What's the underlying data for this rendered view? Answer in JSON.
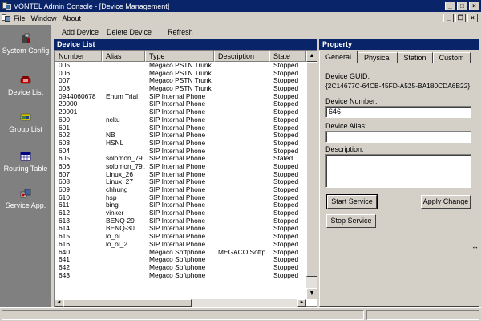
{
  "window": {
    "title": "VONTEL Admin Console - [Device Management]",
    "minimize": "_",
    "maximize": "□",
    "close": "×"
  },
  "menu": {
    "items": [
      {
        "label": "File"
      },
      {
        "label": "Window"
      },
      {
        "label": "About"
      }
    ],
    "mdi_min": "_",
    "mdi_restore": "❐",
    "mdi_close": "×"
  },
  "sidebar": {
    "items": [
      {
        "label": "System Config",
        "icon": "tools-icon"
      },
      {
        "label": "Device List",
        "icon": "phone-icon"
      },
      {
        "label": "Group List",
        "icon": "group-icon"
      },
      {
        "label": "Routing Table",
        "icon": "table-icon"
      },
      {
        "label": "Service App.",
        "icon": "service-icon"
      }
    ]
  },
  "toolbar": {
    "add_device": "Add Device",
    "delete_device": "Delete Device",
    "refresh": "Refresh"
  },
  "device_list": {
    "header": "Device List",
    "columns": [
      "Number",
      "Alias",
      "Type",
      "Description",
      "State"
    ],
    "rows": [
      [
        "005",
        "",
        "Megaco PSTN Trunk",
        "",
        "Stopped"
      ],
      [
        "006",
        "",
        "Megaco PSTN Trunk",
        "",
        "Stopped"
      ],
      [
        "007",
        "",
        "Megaco PSTN Trunk",
        "",
        "Stopped"
      ],
      [
        "008",
        "",
        "Megaco PSTN Trunk",
        "",
        "Stopped"
      ],
      [
        "0944060678",
        "Enum Trial",
        "SIP Internal Phone",
        "",
        "Stopped"
      ],
      [
        "20000",
        "",
        "SIP Internal Phone",
        "",
        "Stopped"
      ],
      [
        "20001",
        "",
        "SIP Internal Phone",
        "",
        "Stopped"
      ],
      [
        "600",
        "ncku",
        "SIP Internal Phone",
        "",
        "Stopped"
      ],
      [
        "601",
        "",
        "SIP Internal Phone",
        "",
        "Stopped"
      ],
      [
        "602",
        "NB",
        "SIP Internal Phone",
        "",
        "Stopped"
      ],
      [
        "603",
        "HSNL",
        "SIP Internal Phone",
        "",
        "Stopped"
      ],
      [
        "604",
        "",
        "SIP Internal Phone",
        "",
        "Stopped"
      ],
      [
        "605",
        "solomon_79...",
        "SIP Internal Phone",
        "",
        "Stated"
      ],
      [
        "606",
        "solomon_79...",
        "SIP Internal Phone",
        "",
        "Stopped"
      ],
      [
        "607",
        "Linux_26",
        "SIP Internal Phone",
        "",
        "Stopped"
      ],
      [
        "608",
        "Linux_27",
        "SIP Internal Phone",
        "",
        "Stopped"
      ],
      [
        "609",
        "chhung",
        "SIP Internal Phone",
        "",
        "Stopped"
      ],
      [
        "610",
        "hsp",
        "SIP Internal Phone",
        "",
        "Stopped"
      ],
      [
        "611",
        "bing",
        "SIP Internal Phone",
        "",
        "Stopped"
      ],
      [
        "612",
        "vinker",
        "SIP Internal Phone",
        "",
        "Stopped"
      ],
      [
        "613",
        "BENQ-29",
        "SIP Internal Phone",
        "",
        "Stopped"
      ],
      [
        "614",
        "BENQ-30",
        "SIP Internal Phone",
        "",
        "Stopped"
      ],
      [
        "615",
        "lo_ol",
        "SIP Internal Phone",
        "",
        "Stopped"
      ],
      [
        "616",
        "lo_ol_2",
        "SIP Internal Phone",
        "",
        "Stopped"
      ],
      [
        "640",
        "",
        "Megaco Softphone",
        "MEGACO Softp..",
        "Stopped"
      ],
      [
        "641",
        "",
        "Megaco Softphone",
        "",
        "Stopped"
      ],
      [
        "642",
        "",
        "Megaco Softphone",
        "",
        "Stopped"
      ],
      [
        "643",
        "",
        "Megaco Softphone",
        "",
        "Stopped"
      ]
    ]
  },
  "property": {
    "header": "Property",
    "tabs": [
      "General",
      "Physical",
      "Station",
      "Custom"
    ],
    "guid_label": "Device GUID:",
    "guid_value": "{2C14677C-64CB-45FD-A525-BA180CDA6B22}",
    "number_label": "Device Number:",
    "number_value": "646",
    "alias_label": "Device Alias:",
    "alias_value": "",
    "description_label": "Description:",
    "description_value": "",
    "start_service": "Start Service",
    "stop_service": "Stop Service",
    "apply_change": "Apply Change"
  },
  "scroll": {
    "up": "▲",
    "down": "▼",
    "left": "◄",
    "right": "►"
  },
  "cursor": "↔"
}
